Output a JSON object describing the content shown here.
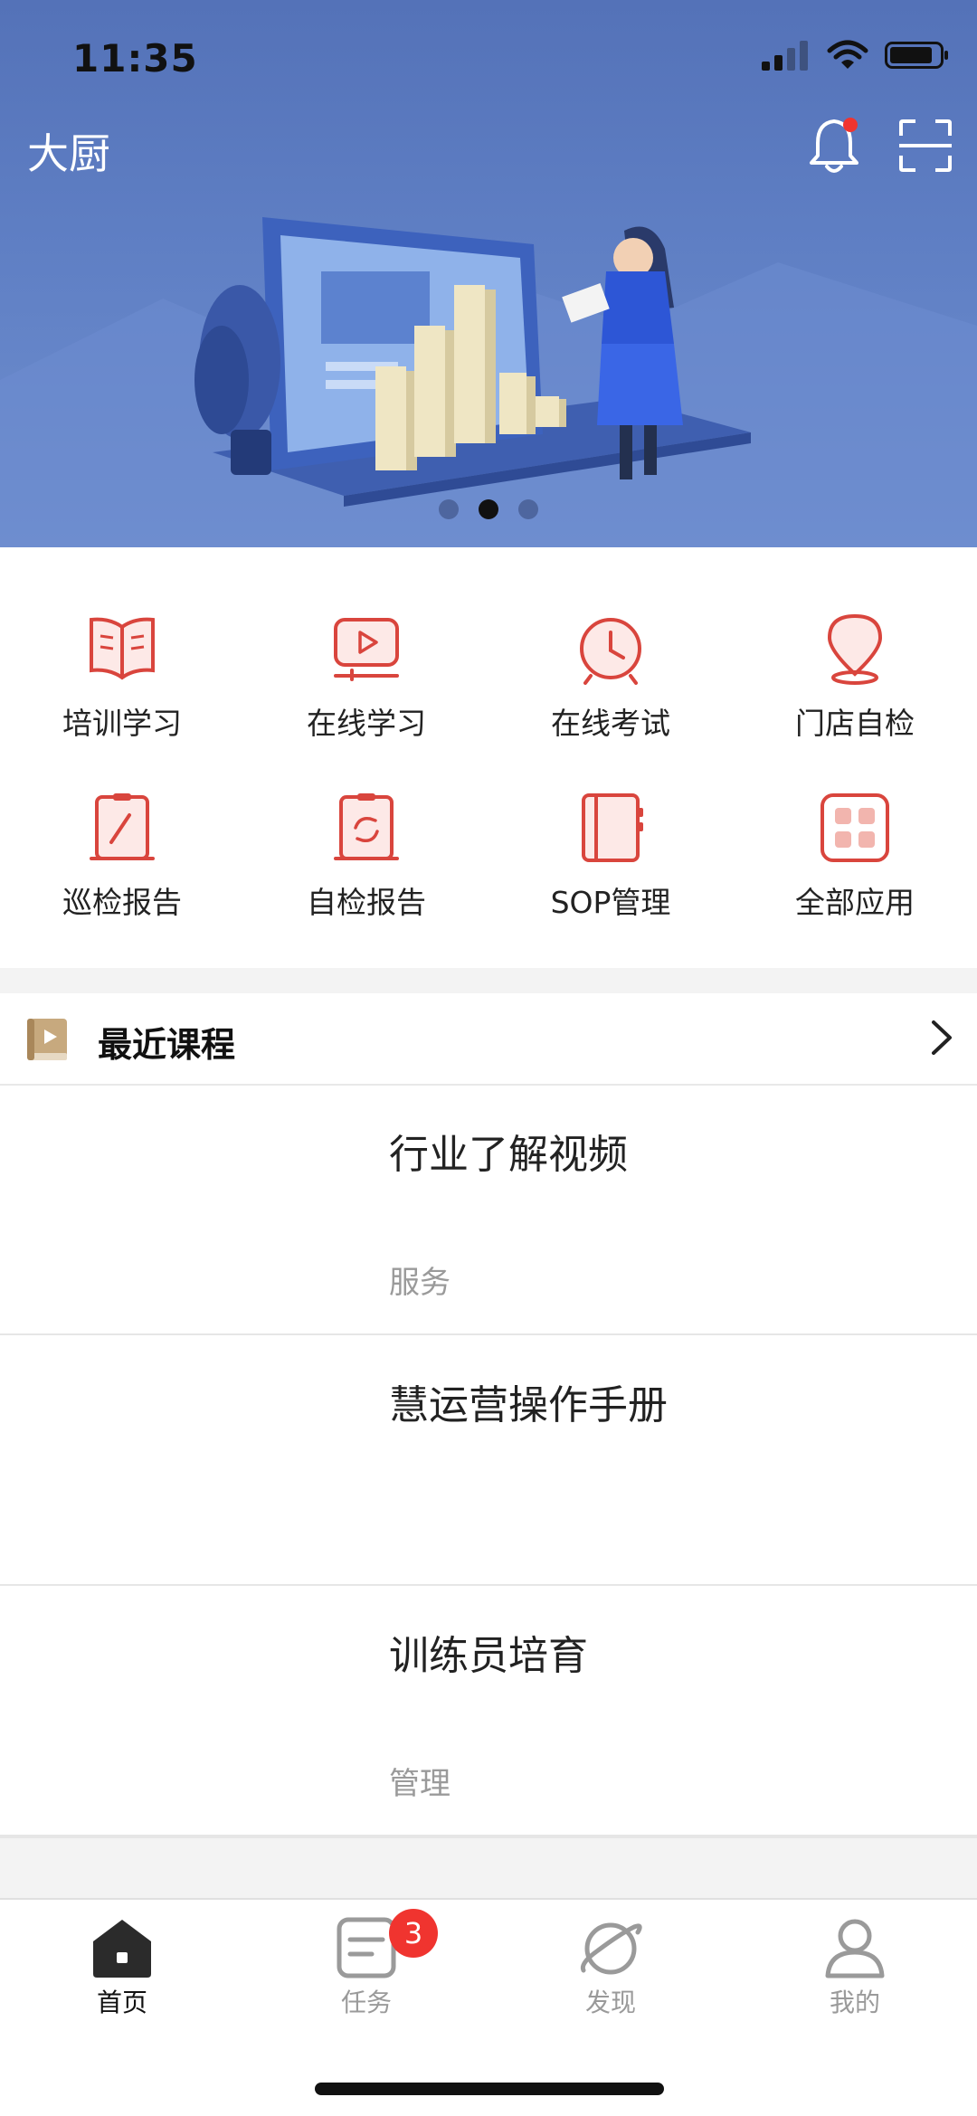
{
  "status_bar": {
    "time": "11:35"
  },
  "header": {
    "title": "大厨"
  },
  "banner": {
    "active_slide": 2,
    "slide_count": 3
  },
  "apps": [
    {
      "label": "培训学习",
      "icon": "open-book-icon"
    },
    {
      "label": "在线学习",
      "icon": "play-screen-icon"
    },
    {
      "label": "在线考试",
      "icon": "alarm-clock-icon"
    },
    {
      "label": "门店自检",
      "icon": "location-pin-icon"
    },
    {
      "label": "巡检报告",
      "icon": "clipboard-pen-icon"
    },
    {
      "label": "自检报告",
      "icon": "clipboard-cycle-icon"
    },
    {
      "label": "SOP管理",
      "icon": "notebook-icon"
    },
    {
      "label": "全部应用",
      "icon": "grid-apps-icon"
    }
  ],
  "recent": {
    "title": "最近课程",
    "courses": [
      {
        "title": "行业了解视频",
        "tag": "服务"
      },
      {
        "title": "慧运营操作手册",
        "tag": ""
      },
      {
        "title": "训练员培育",
        "tag": "管理"
      }
    ]
  },
  "tabbar": {
    "tabs": [
      {
        "label": "首页",
        "icon": "home-icon",
        "active": true
      },
      {
        "label": "任务",
        "icon": "task-icon",
        "badge": "3"
      },
      {
        "label": "发现",
        "icon": "planet-icon"
      },
      {
        "label": "我的",
        "icon": "user-icon"
      }
    ]
  },
  "colors": {
    "accent": "#d9453d",
    "badge": "#f0342f",
    "banner": "#5f7fc4"
  }
}
